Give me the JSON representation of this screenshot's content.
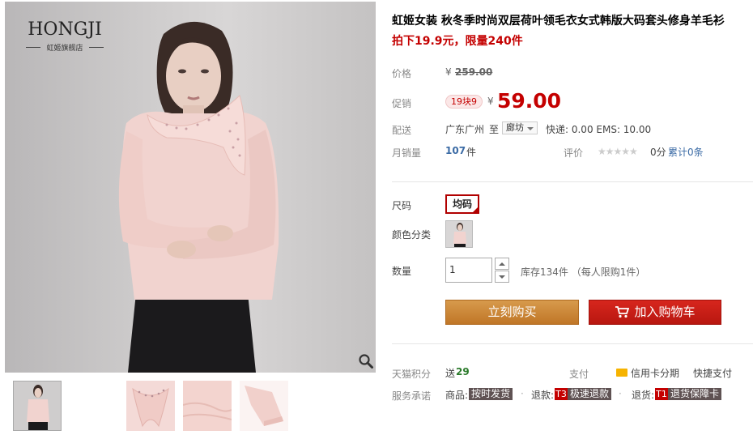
{
  "brand": {
    "name": "HONGJI",
    "subtitle": "虹姬旗舰店"
  },
  "product": {
    "title": "虹姬女装 秋冬季时尚双层荷叶领毛衣女式韩版大码套头修身羊毛衫",
    "promo_line": "拍下19.9元，限量240件"
  },
  "price": {
    "label": "价格",
    "currency": "¥",
    "original": "259.00",
    "promo_label": "促销",
    "promo_tag": "19块9",
    "current": "59.00"
  },
  "shipping": {
    "label": "配送",
    "from": "广东广州",
    "to_word": "至",
    "to_city": "廊坊",
    "express": "快递: 0.00 EMS: 10.00"
  },
  "sales": {
    "label": "月销量",
    "count": "107",
    "unit": "件",
    "rating_label": "评价",
    "stars": "★★★★★",
    "score": "0分",
    "total": "累计0条"
  },
  "options": {
    "size_label": "尺码",
    "size_value": "均码",
    "color_label": "颜色分类"
  },
  "quantity": {
    "label": "数量",
    "value": "1",
    "stock": "库存134件 （每人限购1件）"
  },
  "actions": {
    "buy_now": "立刻购买",
    "add_to_cart": "加入购物车"
  },
  "points": {
    "label": "天猫积分",
    "send": "送",
    "amount": "29",
    "pay_label": "支付",
    "credit": "信用卡分期",
    "quick_pay": "快捷支付"
  },
  "service": {
    "label": "服务承诺",
    "goods": "商品:",
    "goods_tag": "按时发货",
    "refund": "退款:",
    "refund_badge": "T3",
    "refund_tag": "极速退款",
    "return": "退货:",
    "return_badge": "T1",
    "return_tag": "退货保障卡",
    "separator": "·"
  },
  "colors": {
    "accent_red": "#c40000",
    "buy_orange": "#c97f32",
    "sweater_pink": "#f1d3cf"
  },
  "icons": [
    "zoom-icon",
    "cart-icon",
    "credit-card-icon",
    "chevron-up-icon",
    "chevron-down-icon"
  ]
}
